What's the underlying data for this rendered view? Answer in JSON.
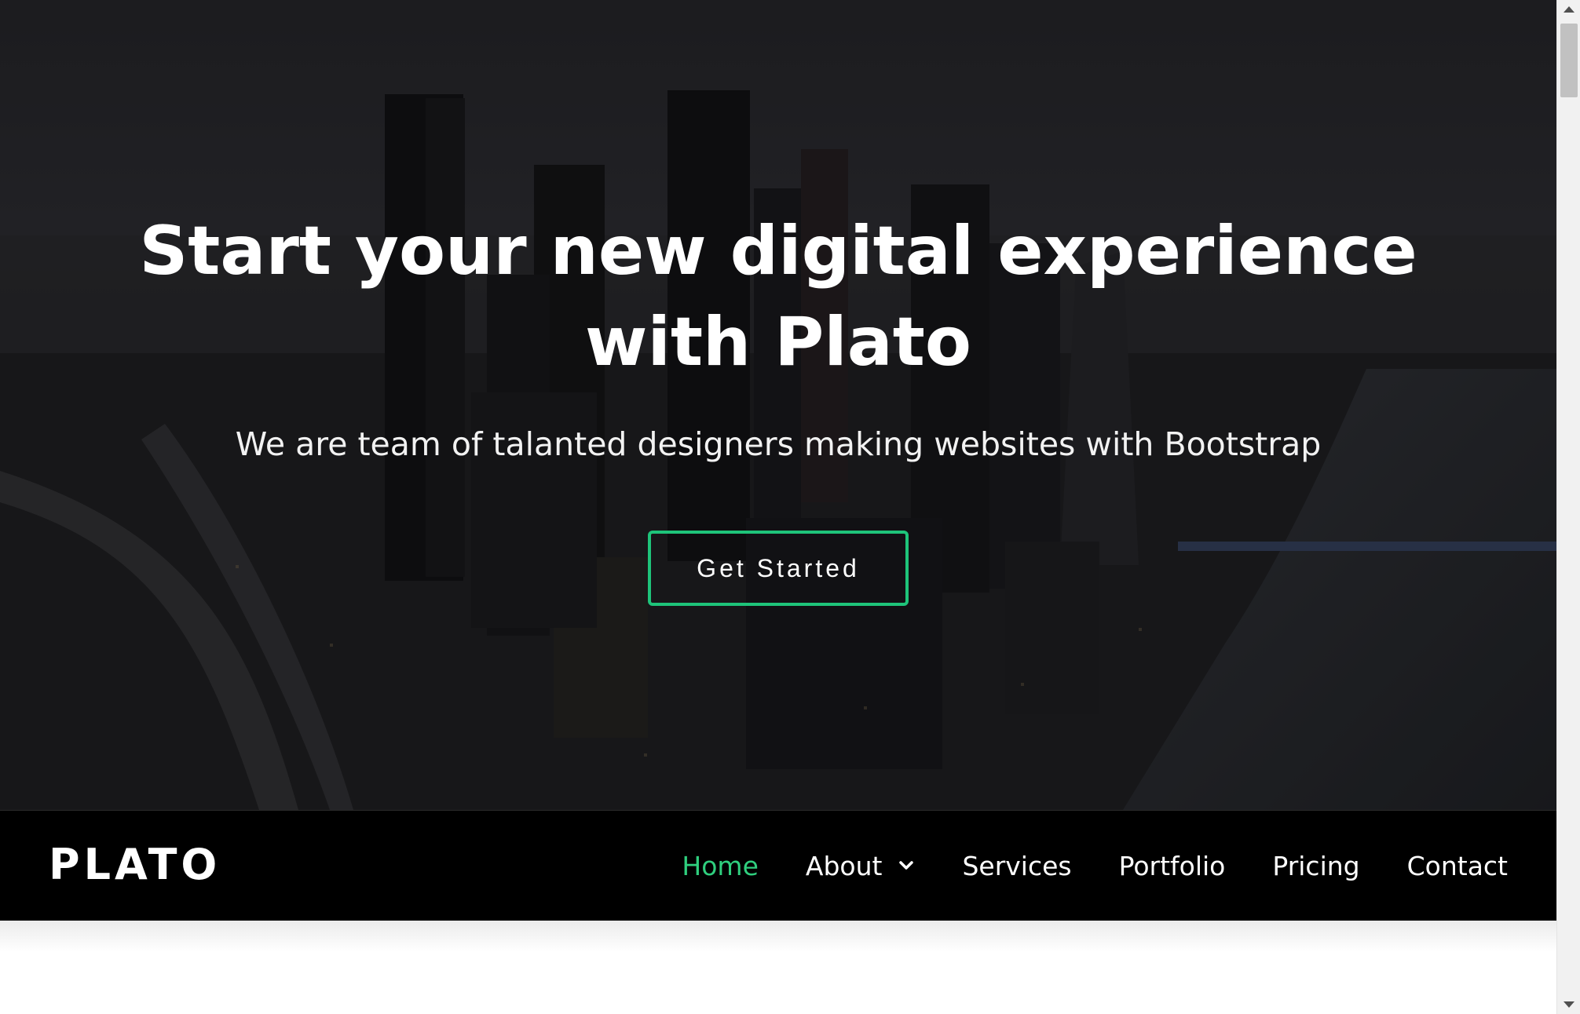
{
  "hero": {
    "title": "Start your new digital experience with Plato",
    "subtitle": "We are team of talanted designers making websites with Bootstrap",
    "cta_label": "Get Started",
    "background": "city-skyline-image"
  },
  "navbar": {
    "brand": "PLATO",
    "items": [
      {
        "label": "Home",
        "active": true
      },
      {
        "label": "About",
        "has_dropdown": true
      },
      {
        "label": "Services"
      },
      {
        "label": "Portfolio"
      },
      {
        "label": "Pricing"
      },
      {
        "label": "Contact"
      }
    ]
  },
  "colors": {
    "accent": "#1ec47a",
    "active_nav": "#2fcf7e",
    "navbar_bg": "#000000",
    "text": "#ffffff"
  },
  "icons": {
    "dropdown": "chevron-down-icon"
  }
}
